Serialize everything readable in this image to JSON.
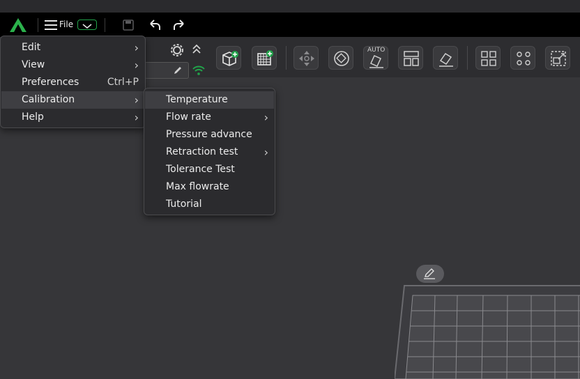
{
  "menubar": {
    "file_label": "File"
  },
  "main_menu": {
    "items": [
      {
        "label": "Edit",
        "shortcut": "",
        "submenu": true
      },
      {
        "label": "View",
        "shortcut": "",
        "submenu": true
      },
      {
        "label": "Preferences",
        "shortcut": "Ctrl+P",
        "submenu": false
      },
      {
        "label": "Calibration",
        "shortcut": "",
        "submenu": true
      },
      {
        "label": "Help",
        "shortcut": "",
        "submenu": true
      }
    ]
  },
  "calibration_menu": {
    "items": [
      {
        "label": "Temperature",
        "submenu": false
      },
      {
        "label": "Flow rate",
        "submenu": true
      },
      {
        "label": "Pressure advance",
        "submenu": false
      },
      {
        "label": "Retraction test",
        "submenu": true
      },
      {
        "label": "Tolerance Test",
        "submenu": false
      },
      {
        "label": "Max flowrate",
        "submenu": false
      },
      {
        "label": "Tutorial",
        "submenu": false
      }
    ]
  },
  "toolbar": {
    "auto_label": "AUTO"
  },
  "colors": {
    "accent": "#21a34a",
    "background": "#363639",
    "menu_bg": "#2b2b2e"
  }
}
